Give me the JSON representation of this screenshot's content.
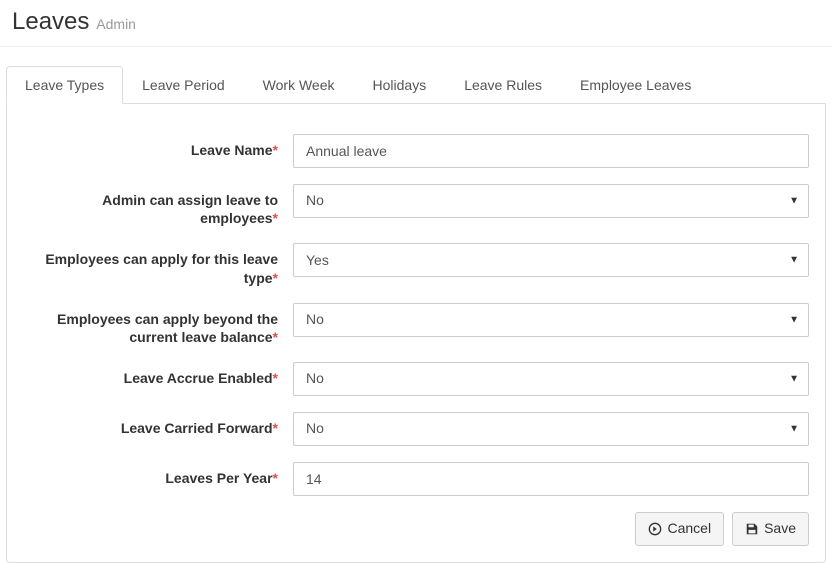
{
  "header": {
    "title": "Leaves",
    "subtitle": "Admin"
  },
  "tabs": {
    "items": [
      {
        "label": "Leave Types"
      },
      {
        "label": "Leave Period"
      },
      {
        "label": "Work Week"
      },
      {
        "label": "Holidays"
      },
      {
        "label": "Leave Rules"
      },
      {
        "label": "Employee Leaves"
      }
    ]
  },
  "form": {
    "leave_name": {
      "label": "Leave Name",
      "value": "Annual leave"
    },
    "admin_assign": {
      "label": "Admin can assign leave to employees",
      "value": "No"
    },
    "emp_apply": {
      "label": "Employees can apply for this leave type",
      "value": "Yes"
    },
    "emp_beyond": {
      "label": "Employees can apply beyond the current leave balance",
      "value": "No"
    },
    "accrue": {
      "label": "Leave Accrue Enabled",
      "value": "No"
    },
    "carried": {
      "label": "Leave Carried Forward",
      "value": "No"
    },
    "per_year": {
      "label": "Leaves Per Year",
      "value": "14"
    }
  },
  "buttons": {
    "cancel": "Cancel",
    "save": "Save"
  }
}
